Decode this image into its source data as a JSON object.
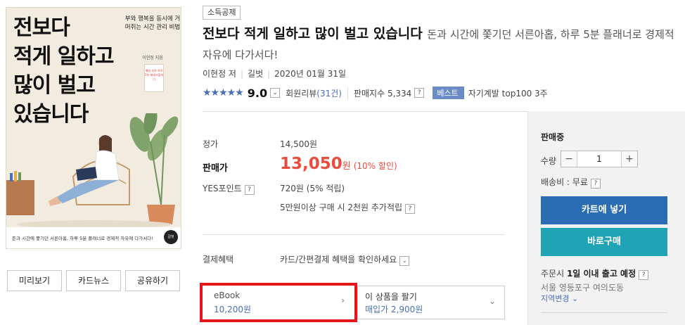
{
  "cover": {
    "title_lines": [
      "전보다",
      "적게 일하고",
      "많이 벌고",
      "있습니다"
    ],
    "subtitle": "부와 행복을 동시에 거머쥐는 시간 관리 비법",
    "author_small": "이현정 지음",
    "sticker_text": "매일 부자 하루 5분 재테크플래너",
    "tagline": "돈과 시간에 쫓기던 서른아홉, 하루 5분 플래너로 경제적 자유에 다가서다!",
    "publisher_logo": "길벗"
  },
  "cover_buttons": {
    "preview": "미리보기",
    "cardnews": "카드뉴스",
    "share": "공유하기"
  },
  "header": {
    "category": "소득공제",
    "title": "전보다 적게 일하고 많이 벌고 있습니다",
    "subtitle": "돈과 시간에 쫓기던 서른아홉, 하루 5분 플래너로 경제적 자유에 다가서다!",
    "author": "이현정 저",
    "publisher": "길벗",
    "date": "2020년 01월 31일"
  },
  "rating": {
    "stars": "★★★★★",
    "score": "9.0",
    "review_label": "회원리뷰",
    "review_count": "(31건)",
    "sales_index": "판매지수 5,334",
    "best_badge": "베스트",
    "best_text": "자기계발 top100 3주",
    "score_fraction": 0.9
  },
  "price": {
    "list_label": "정가",
    "list_value": "14,500원",
    "sale_label": "판매가",
    "sale_value": "13,050",
    "sale_unit": "원",
    "discount": "(10% 할인)",
    "point_label": "YES포인트",
    "point_value": "720원 (5% 적립)",
    "extra_point": "5만원이상 구매 시 2천원 추가적립",
    "payment_label": "결제혜택",
    "payment_value": "카드/간편결제 혜택을 확인하세요"
  },
  "ebook": {
    "label": "eBook",
    "price": "10,200원"
  },
  "sell": {
    "label": "이 상품을 팔기",
    "price": "매입가 2,900원"
  },
  "buy_panel": {
    "status": "판매중",
    "qty_label": "수량",
    "qty_value": "1",
    "shipping": "배송비 : 무료",
    "cart_button": "카트에 넣기",
    "buy_button": "바로구매",
    "delivery_prefix": "주문시",
    "delivery_bold": "1일 이내 출고 예정",
    "address": "서울 영등포구 여의도동",
    "region_change": "지역변경"
  },
  "colors": {
    "accent_blue": "#2a6db5",
    "buy_teal": "#1fa3b5",
    "price_red": "#e84c3d",
    "highlight_red": "#e3161c",
    "link_blue": "#4a6fb5"
  }
}
